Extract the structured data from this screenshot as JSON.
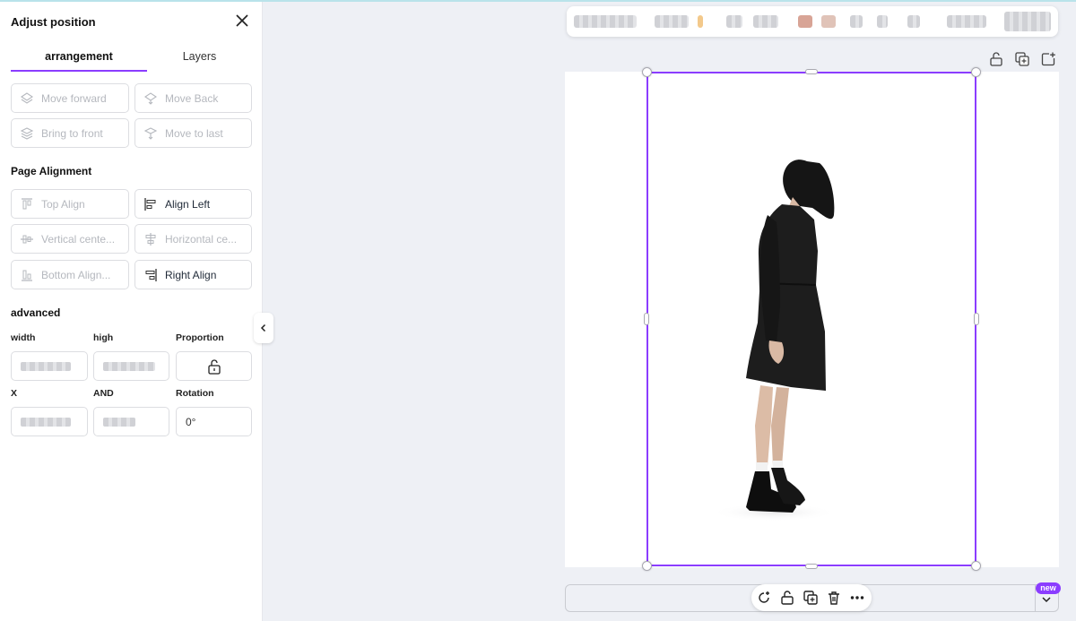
{
  "panel": {
    "title": "Adjust position",
    "tabs": [
      "arrangement",
      "Layers"
    ],
    "order_buttons": [
      "Move forward",
      "Move Back",
      "Bring to front",
      "Move to last"
    ],
    "alignment_heading": "Page Alignment",
    "alignment_buttons": [
      "Top Align",
      "Align Left",
      "Vertical cente...",
      "Horizontal ce...",
      "Bottom Align...",
      "Right Align"
    ],
    "advanced_heading": "advanced",
    "labels": {
      "width": "width",
      "high": "high",
      "proportion": "Proportion",
      "x": "X",
      "and": "AND",
      "rotation": "Rotation"
    },
    "rotation_value": "0°"
  },
  "bottom": {
    "new_badge": "new"
  },
  "colors": {
    "accent": "#8b3dff",
    "canvas_bg": "#eef0f5",
    "page_bg": "#ffffff"
  },
  "icons": [
    "close-icon",
    "move-forward-icon",
    "move-back-icon",
    "bring-front-icon",
    "move-last-icon",
    "top-align-icon",
    "align-left-icon",
    "vertical-center-icon",
    "horizontal-center-icon",
    "bottom-align-icon",
    "right-align-icon",
    "lock-icon",
    "copy-icon",
    "add-page-icon",
    "rotate-icon",
    "trash-icon",
    "more-icon",
    "chevron-left-icon",
    "chevron-down-icon"
  ]
}
